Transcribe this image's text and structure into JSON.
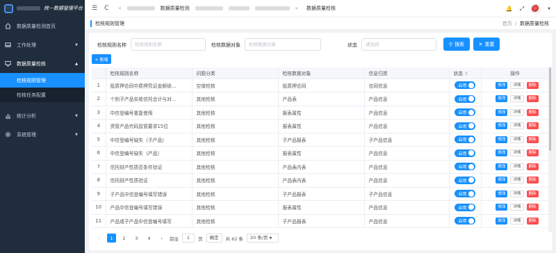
{
  "app": {
    "title": "统一数据管理平台"
  },
  "sidebar": {
    "items": [
      {
        "label": "数据质量检测首页",
        "icon": "home-icon"
      },
      {
        "label": "工作处理",
        "icon": "inbox-icon",
        "arrow": "▼"
      },
      {
        "label": "数据质量检核",
        "icon": "monitor-icon",
        "arrow": "▲"
      },
      {
        "label": "统计分析",
        "icon": "chart-icon",
        "arrow": "▼"
      },
      {
        "label": "系统管理",
        "icon": "gear-icon",
        "arrow": "▼"
      }
    ],
    "sub_items": [
      {
        "label": "检核规则管理"
      },
      {
        "label": "检核任务配置"
      }
    ]
  },
  "topbar": {
    "menu_icon": "☰",
    "refresh_icon": "C",
    "back_icon": "«",
    "forward_icon": "»",
    "tab1": "数据质量检测",
    "tab2": "数据质量检核",
    "bell_icon": "🔔",
    "expand_icon": "⤢",
    "user_arrow": "▼"
  },
  "subhead": {
    "title": "检核规则管理",
    "crumb_home": "首页",
    "crumb_sep": "/",
    "crumb_current": "数据质量检核"
  },
  "search": {
    "name_label": "检核规则名称",
    "name_placeholder": "检核规则名称",
    "object_label": "检核数据对象",
    "object_placeholder": "检核数据对象",
    "status_label": "状态",
    "status_placeholder": "请选择",
    "search_btn": "搜索",
    "reset_btn": "重置",
    "add_btn": "+ 新增"
  },
  "table": {
    "headers": [
      "",
      "检核规则名称",
      "问题分类",
      "检核数据对象",
      "信息归类",
      "状态",
      "操作"
    ],
    "rows": [
      {
        "no": "1",
        "name": "抵质押合同中质押凭证金额徐...",
        "type": "空值检核",
        "object": "抵质押合同",
        "cat": "合同信息"
      },
      {
        "no": "2",
        "name": "个别子产品实收信托合计与对...",
        "type": "其他检核",
        "object": "产品表",
        "cat": "产品信息"
      },
      {
        "no": "3",
        "name": "中信登编号重复使用",
        "type": "其他检核",
        "object": "报表属性",
        "cat": "产品信息"
      },
      {
        "no": "4",
        "name": "资管产品代码监管要求15位",
        "type": "其他检核",
        "object": "报表属性",
        "cat": "产品信息"
      },
      {
        "no": "5",
        "name": "中信登编号缺失（子产品）",
        "type": "其他检核",
        "object": "子产品报表",
        "cat": "子产品信息"
      },
      {
        "no": "6",
        "name": "中信登编号缺失（产品）",
        "type": "其他检核",
        "object": "报表属性",
        "cat": "产品信息"
      },
      {
        "no": "7",
        "name": "信托财产性质否条件验证",
        "type": "其他检核",
        "object": "产品表内表",
        "cat": "产品信息"
      },
      {
        "no": "8",
        "name": "信托财产性质验证",
        "type": "其他检核",
        "object": "产品表内表",
        "cat": "产品信息"
      },
      {
        "no": "9",
        "name": "子产品中信登编号填写错误",
        "type": "其他检核",
        "object": "子产品报表",
        "cat": "子产品信息"
      },
      {
        "no": "10",
        "name": "产品中信登编号填写错误",
        "type": "其他检核",
        "object": "报表属性",
        "cat": "产品信息"
      },
      {
        "no": "11",
        "name": "产品或子产品中信登编号填写",
        "type": "其他检核",
        "object": "子产品报表",
        "cat": "产品信息"
      }
    ],
    "toggle_label": "启用",
    "edit_label": "修改",
    "detail_label": "详情",
    "delete_label": "删除"
  },
  "pager": {
    "prev": "‹",
    "pages": [
      "1",
      "2",
      "3",
      "4"
    ],
    "next": "›",
    "goto_label": "前往",
    "goto_value": "1",
    "page_unit": "页",
    "confirm": "确定",
    "total": "共 62 条",
    "size": "20 条/页"
  }
}
